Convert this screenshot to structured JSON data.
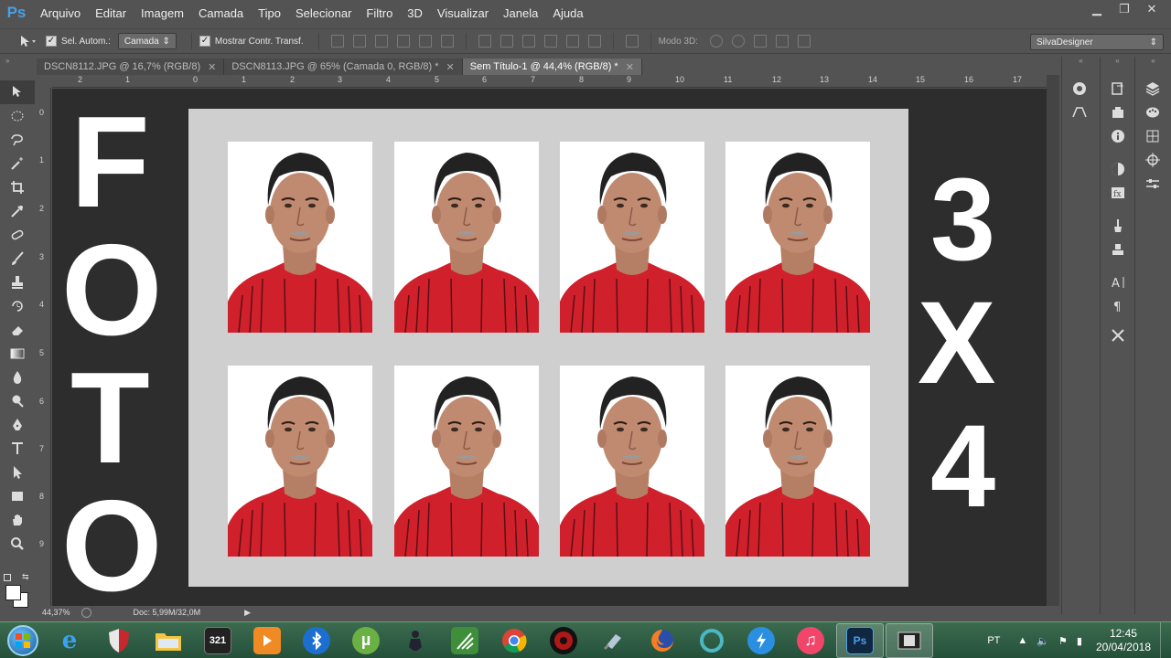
{
  "app": {
    "logo": "Ps"
  },
  "menus": [
    "Arquivo",
    "Editar",
    "Imagem",
    "Camada",
    "Tipo",
    "Selecionar",
    "Filtro",
    "3D",
    "Visualizar",
    "Janela",
    "Ajuda"
  ],
  "window_controls": {
    "minimize": "▁",
    "restore": "❐",
    "close": "✕"
  },
  "options_bar": {
    "auto_select_label": "Sel. Autom.:",
    "auto_select_checked": true,
    "auto_select_target": "Camada",
    "show_transform_label": "Mostrar Contr. Transf.",
    "show_transform_checked": true,
    "mode_3d_label": "Modo 3D:",
    "workspace": "SilvaDesigner"
  },
  "tabs": [
    {
      "label": "DSCN8112.JPG @ 16,7% (RGB/8)",
      "active": false
    },
    {
      "label": "DSCN8113.JPG @ 65% (Camada 0, RGB/8) *",
      "active": false
    },
    {
      "label": "Sem Título-1 @ 44,4% (RGB/8) *",
      "active": true
    }
  ],
  "ruler_top_ticks": [
    "2",
    "1",
    "0",
    "1",
    "2",
    "3",
    "4",
    "5",
    "6",
    "7",
    "8",
    "9",
    "10",
    "11",
    "12",
    "13",
    "14",
    "15",
    "16",
    "17"
  ],
  "ruler_left_ticks": [
    "0",
    "1",
    "2",
    "3",
    "4",
    "5",
    "6",
    "7",
    "8",
    "9"
  ],
  "canvas": {
    "left_word": [
      "F",
      "O",
      "T",
      "O"
    ],
    "right_word": [
      "3",
      "X",
      "4"
    ],
    "photo_grid": {
      "rows": 2,
      "cols": 4
    },
    "colors": {
      "background": "#2d2d2d",
      "paper": "#cfcfcf",
      "shirt": "#d0202b",
      "text": "#ffffff"
    }
  },
  "status": {
    "zoom": "44,37%",
    "doc": "Doc: 5,99M/32,0M"
  },
  "tools": [
    "move-tool",
    "marquee-tool",
    "lasso-tool",
    "quick-select-tool",
    "crop-tool",
    "eyedropper-tool",
    "healing-tool",
    "brush-tool",
    "stamp-tool",
    "history-brush-tool",
    "eraser-tool",
    "gradient-tool",
    "blur-tool",
    "dodge-tool",
    "pen-tool",
    "type-tool",
    "path-select-tool",
    "rectangle-tool",
    "hand-tool",
    "zoom-tool"
  ],
  "taskbar": {
    "apps": [
      "ie",
      "shield",
      "explorer",
      "media-player-classic",
      "video-player",
      "bluetooth",
      "utorrent",
      "counter-strike",
      "vegas",
      "chrome",
      "record",
      "usb",
      "firefox",
      "cortana-circle",
      "flash",
      "itunes",
      "photoshop",
      "film"
    ],
    "active_apps": [
      "photoshop",
      "film"
    ],
    "lang": "PT",
    "time": "12:45",
    "date": "20/04/2018"
  }
}
